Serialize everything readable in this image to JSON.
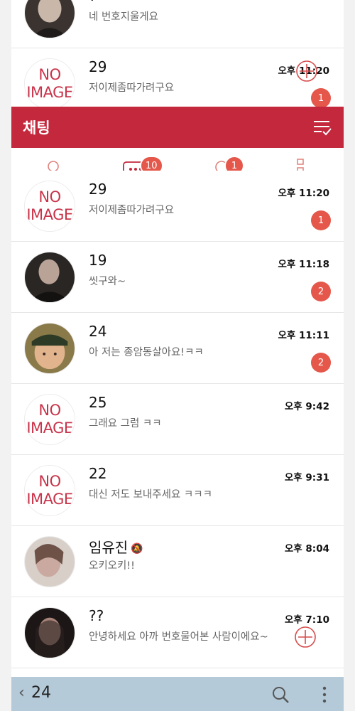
{
  "colors": {
    "header": "#c3283c",
    "accent": "#e4574a",
    "bottom_bar": "#b4cad9"
  },
  "top_rows": [
    {
      "name": "?",
      "message": "네 번호지울게요",
      "time": "",
      "avatar": "photo-dark",
      "badge": ""
    },
    {
      "name": "29",
      "message": "저이제좀따가려구요",
      "time": "오후 11:20",
      "avatar": "NO IMAGE",
      "badge": "1"
    }
  ],
  "header": {
    "title": "채팅",
    "menu_icon": "sort-check-icon"
  },
  "tabs": [
    {
      "id": "friends",
      "icon": "person-icon",
      "badge": ""
    },
    {
      "id": "chats",
      "icon": "chat-bubble-icon",
      "badge": "10"
    },
    {
      "id": "search",
      "icon": "search-icon",
      "badge": "1"
    },
    {
      "id": "more",
      "icon": "more-dots-icon",
      "badge": ""
    }
  ],
  "chat_rows": [
    {
      "name": "29",
      "message": "저이제좀따가려구요",
      "time": "오후 11:20",
      "avatar": "NO IMAGE",
      "badge": "1"
    },
    {
      "name": "19",
      "message": "씻구와~",
      "time": "오후 11:18",
      "avatar": "photo-dark",
      "badge": "2"
    },
    {
      "name": "24",
      "message": "아 저는 종암동살아요!ㅋㅋ",
      "time": "오후 11:11",
      "avatar": "photo-child",
      "badge": "2"
    },
    {
      "name": "25",
      "message": "그래요 그럼 ㅋㅋ",
      "time": "오후 9:42",
      "avatar": "NO IMAGE",
      "badge": ""
    },
    {
      "name": "22",
      "message": "대신 저도 보내주세요 ㅋㅋㅋ",
      "time": "오후 9:31",
      "avatar": "NO IMAGE",
      "badge": ""
    },
    {
      "name": "임유진",
      "message": "오키오키!!",
      "time": "오후 8:04",
      "avatar": "photo-light",
      "badge": "",
      "muted": true
    },
    {
      "name": "??",
      "message": "안녕하세요 아까 번호물어본 사람이에요~",
      "time": "오후 7:10",
      "avatar": "photo-dark",
      "badge": ""
    }
  ],
  "no_image": {
    "line1": "NO",
    "line2": "IMAGE"
  },
  "bottom_bar": {
    "back_icon": "‹",
    "count": "24"
  }
}
